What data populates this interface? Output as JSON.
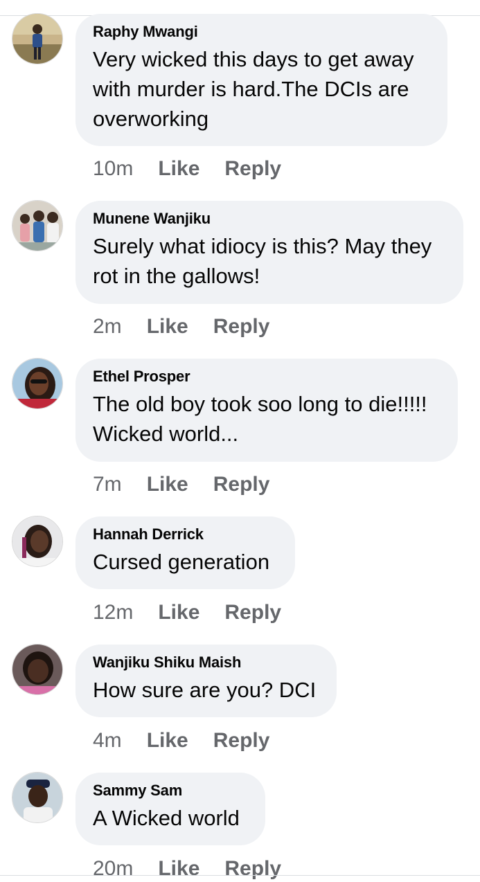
{
  "comments": [
    {
      "author": "Raphy Mwangi",
      "text": "Very wicked this days to get away with murder is hard.The DCIs are overworking",
      "time": "10m",
      "like_label": "Like",
      "reply_label": "Reply"
    },
    {
      "author": "Munene Wanjiku",
      "text": "Surely what idiocy is this? May they rot in the gallows!",
      "time": "2m",
      "like_label": "Like",
      "reply_label": "Reply"
    },
    {
      "author": "Ethel Prosper",
      "text": "The old boy took soo long to die!!!!! Wicked world...",
      "time": "7m",
      "like_label": "Like",
      "reply_label": "Reply"
    },
    {
      "author": "Hannah Derrick",
      "text": "Cursed generation",
      "time": "12m",
      "like_label": "Like",
      "reply_label": "Reply"
    },
    {
      "author": "Wanjiku Shiku Maish",
      "text": "How sure are you? DCI",
      "time": "4m",
      "like_label": "Like",
      "reply_label": "Reply"
    },
    {
      "author": "Sammy Sam",
      "text": "A Wicked world",
      "time": "20m",
      "like_label": "Like",
      "reply_label": "Reply"
    }
  ],
  "colors": {
    "bubble": "#f0f2f5",
    "secondary_text": "#65676b",
    "primary_text": "#050505"
  }
}
